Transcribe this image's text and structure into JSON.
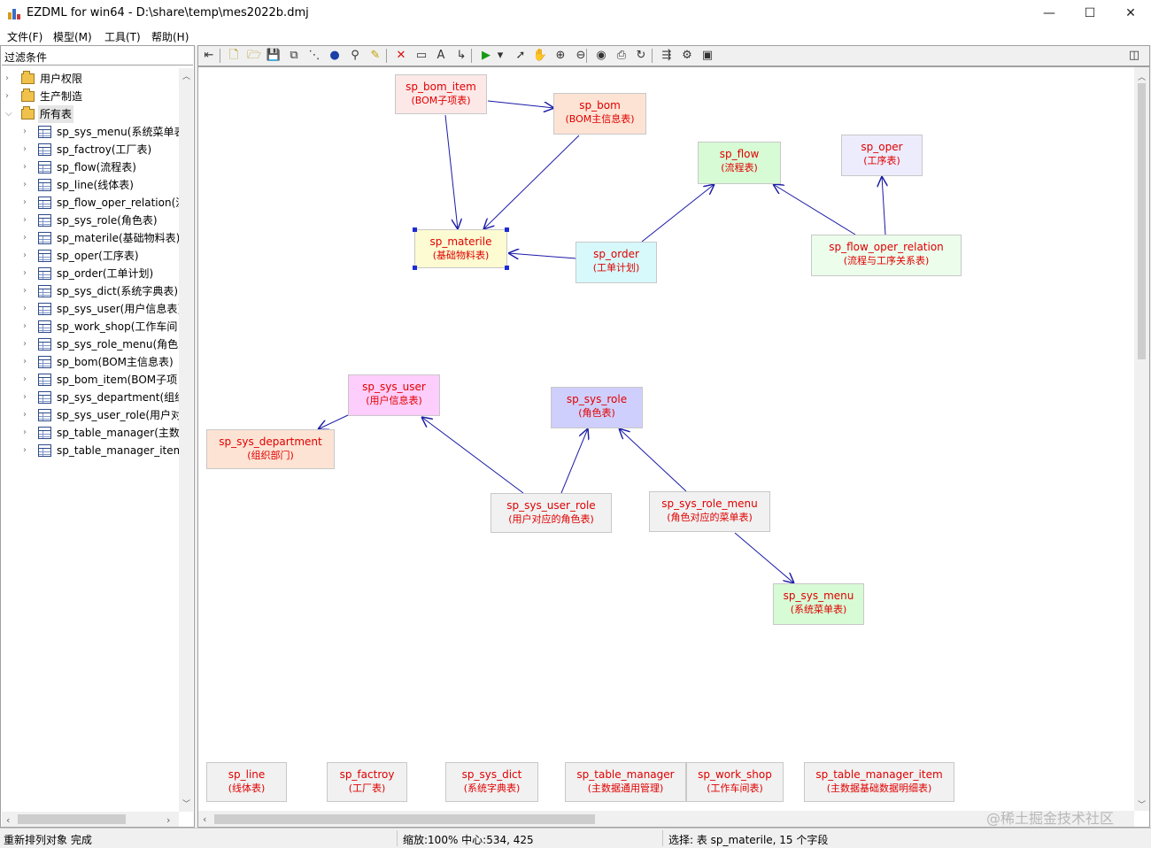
{
  "window": {
    "title": "EZDML for win64 - D:\\share\\temp\\mes2022b.dmj",
    "minimize_glyph": "—",
    "maximize_glyph": "☐",
    "close_glyph": "✕"
  },
  "menu": [
    {
      "label": "文件(F)"
    },
    {
      "label": "模型(M)"
    },
    {
      "label": "工具(T)"
    },
    {
      "label": "帮助(H)"
    }
  ],
  "sidebar": {
    "filter_label": "过滤条件",
    "folders": [
      {
        "label": "用户权限",
        "expanded": false
      },
      {
        "label": "生产制造",
        "expanded": false
      },
      {
        "label": "所有表",
        "expanded": true,
        "selected": true
      }
    ],
    "tables": [
      {
        "label": "sp_sys_menu(系统菜单表"
      },
      {
        "label": "sp_factroy(工厂表)"
      },
      {
        "label": "sp_flow(流程表)"
      },
      {
        "label": "sp_line(线体表)"
      },
      {
        "label": "sp_flow_oper_relation(流"
      },
      {
        "label": "sp_sys_role(角色表)"
      },
      {
        "label": "sp_materile(基础物料表)"
      },
      {
        "label": "sp_oper(工序表)"
      },
      {
        "label": "sp_order(工单计划)"
      },
      {
        "label": "sp_sys_dict(系统字典表)"
      },
      {
        "label": "sp_sys_user(用户信息表)"
      },
      {
        "label": "sp_work_shop(工作车间"
      },
      {
        "label": "sp_sys_role_menu(角色对"
      },
      {
        "label": "sp_bom(BOM主信息表)"
      },
      {
        "label": "sp_bom_item(BOM子项"
      },
      {
        "label": "sp_sys_department(组织"
      },
      {
        "label": "sp_sys_user_role(用户对"
      },
      {
        "label": "sp_table_manager(主数"
      },
      {
        "label": "sp_table_manager_item"
      }
    ]
  },
  "toolbar": {
    "icons": [
      "panel-toggle-icon",
      "new-file-icon",
      "open-folder-icon",
      "save-icon",
      "copy-icon",
      "layout-icon",
      "globe-icon",
      "find-icon",
      "highlight-icon",
      "delete-icon",
      "table-icon",
      "text-icon",
      "link-icon",
      "run-icon",
      "dropdown-icon",
      "pointer-icon",
      "hand-icon",
      "zoom-in-icon",
      "zoom-out-icon",
      "eye-icon",
      "print-icon",
      "refresh-icon",
      "export-icon",
      "settings-icon",
      "picture-icon",
      "split-view-icon"
    ]
  },
  "diagram": {
    "colors": {
      "entity_text": "#e00000",
      "link": "#1a1aa6",
      "selection_handle": "#1f2bd6"
    },
    "entities": [
      {
        "id": "bom_item",
        "name": "sp_bom_item",
        "comment": "(BOM子项表)",
        "bg": "#fde8e8"
      },
      {
        "id": "bom",
        "name": "sp_bom",
        "comment": "(BOM主信息表)",
        "bg": "#fde3d4"
      },
      {
        "id": "flow",
        "name": "sp_flow",
        "comment": "(流程表)",
        "bg": "#d7fbd5"
      },
      {
        "id": "oper",
        "name": "sp_oper",
        "comment": "(工序表)",
        "bg": "#ececfd"
      },
      {
        "id": "materile",
        "name": "sp_materile",
        "comment": "(基础物料表)",
        "bg": "#fdfbd2",
        "selected": true
      },
      {
        "id": "order",
        "name": "sp_order",
        "comment": "(工单计划)",
        "bg": "#d7f9fb"
      },
      {
        "id": "flow_oper_relation",
        "name": "sp_flow_oper_relation",
        "comment": "(流程与工序关系表)",
        "bg": "#ecfdec"
      },
      {
        "id": "sys_user",
        "name": "sp_sys_user",
        "comment": "(用户信息表)",
        "bg": "#fdcdfb"
      },
      {
        "id": "sys_role",
        "name": "sp_sys_role",
        "comment": "(角色表)",
        "bg": "#cfcffd"
      },
      {
        "id": "sys_department",
        "name": "sp_sys_department",
        "comment": "(组织部门)",
        "bg": "#fde3d4"
      },
      {
        "id": "sys_user_role",
        "name": "sp_sys_user_role",
        "comment": "(用户对应的角色表)",
        "bg": "#f1f1f1"
      },
      {
        "id": "sys_role_menu",
        "name": "sp_sys_role_menu",
        "comment": "(角色对应的菜单表)",
        "bg": "#f1f1f1"
      },
      {
        "id": "sys_menu",
        "name": "sp_sys_menu",
        "comment": "(系统菜单表)",
        "bg": "#d7fbd5"
      },
      {
        "id": "line",
        "name": "sp_line",
        "comment": "(线体表)",
        "bg": "#f1f1f1"
      },
      {
        "id": "factroy",
        "name": "sp_factroy",
        "comment": "(工厂表)",
        "bg": "#f1f1f1"
      },
      {
        "id": "sys_dict",
        "name": "sp_sys_dict",
        "comment": "(系统字典表)",
        "bg": "#f1f1f1"
      },
      {
        "id": "table_manager",
        "name": "sp_table_manager",
        "comment": "(主数据通用管理)",
        "bg": "#f1f1f1"
      },
      {
        "id": "work_shop",
        "name": "sp_work_shop",
        "comment": "(工作车间表)",
        "bg": "#f1f1f1"
      },
      {
        "id": "table_manager_item",
        "name": "sp_table_manager_item",
        "comment": "(主数据基础数据明细表)",
        "bg": "#f1f1f1"
      }
    ],
    "links": [
      {
        "from": "bom_item",
        "to": "bom"
      },
      {
        "from": "bom_item",
        "to": "materile"
      },
      {
        "from": "bom",
        "to": "materile"
      },
      {
        "from": "order",
        "to": "materile"
      },
      {
        "from": "order",
        "to": "flow"
      },
      {
        "from": "flow_oper_relation",
        "to": "flow"
      },
      {
        "from": "flow_oper_relation",
        "to": "oper"
      },
      {
        "from": "sys_user",
        "to": "sys_department"
      },
      {
        "from": "sys_user_role",
        "to": "sys_user"
      },
      {
        "from": "sys_user_role",
        "to": "sys_role"
      },
      {
        "from": "sys_role_menu",
        "to": "sys_role"
      },
      {
        "from": "sys_role_menu",
        "to": "sys_menu"
      }
    ]
  },
  "watermark": "@稀土掘金技术社区",
  "status": {
    "message": "重新排列对象 完成",
    "zoom": "缩放:100% 中心:534, 425",
    "selection": "选择: 表 sp_materile, 15 个字段"
  }
}
